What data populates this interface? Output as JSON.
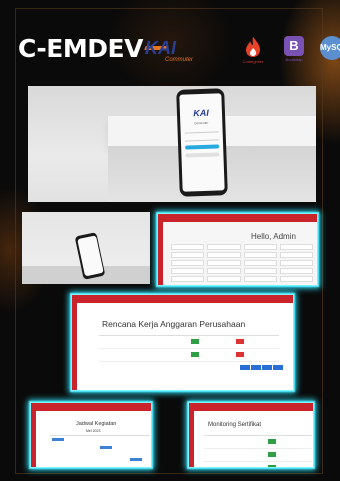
{
  "brand": "C-EMDEV",
  "logos": {
    "kai_main": "KAI",
    "kai_sub": "Commuter",
    "codeigniter": "CodeIgniter",
    "bootstrap_glyph": "B",
    "bootstrap": "Bootstrap",
    "mysql": "MySQL"
  },
  "mockup_screen": {
    "logo": "KAI",
    "logo_sub": "Commuter"
  },
  "dashboard": {
    "greeting": "Hello, Admin"
  },
  "rkap": {
    "title": "Rencana Kerja Anggaran Perusahaan"
  },
  "schedule": {
    "title": "Jadwal Kegiatan",
    "month": "Mei 2023"
  },
  "cert": {
    "title": "Monitoring Sertifikat"
  },
  "colors": {
    "accent_red": "#c9242b",
    "glow": "#2ee6ff",
    "kai_blue": "#2a3f93",
    "kai_orange": "#e8731d"
  }
}
